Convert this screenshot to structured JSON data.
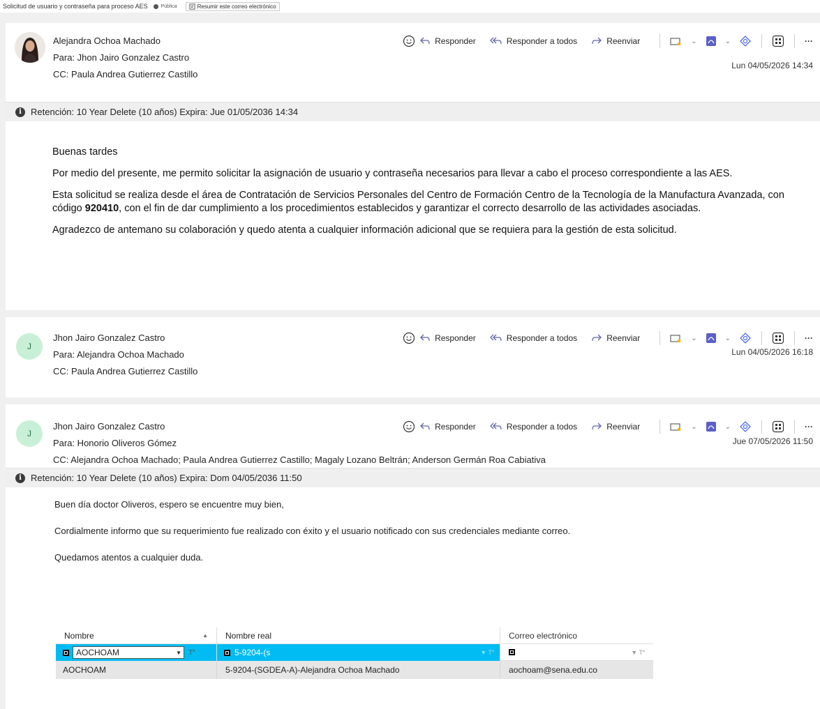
{
  "subject_bar": {
    "title": "Solicitud de usuario y contraseña para proceso AES",
    "sensitivity": "Pública",
    "summarize_label": "Resumir este correo electrónico"
  },
  "actions": {
    "reply": "Responder",
    "reply_all": "Responder a todos",
    "forward": "Reenviar",
    "more": "···"
  },
  "messages": [
    {
      "sender": "Alejandra Ochoa Machado",
      "to": "Para:  Jhon Jairo Gonzalez Castro",
      "cc": "CC:  Paula Andrea Gutierrez Castillo",
      "date": "Lun 04/05/2026 14:34",
      "retention": "Retención: 10 Year Delete (10 años) Expira: Jue 01/05/2036 14:34",
      "body": [
        "Buenas tardes",
        "Por medio del presente, me permito solicitar la asignación de usuario y contraseña necesarios para llevar a cabo el proceso correspondiente a las AES.",
        "Esta solicitud se realiza desde el área de Contratación de Servicios Personales del Centro de Formación Centro de la Tecnología de la Manufactura Avanzada, con código",
        "920410",
        ", con el fin de dar cumplimiento a los procedimientos establecidos y garantizar el correcto desarrollo de las actividades asociadas.",
        "Agradezco de antemano su colaboración y quedo atenta a cualquier información adicional que se requiera para la gestión de esta solicitud."
      ]
    },
    {
      "avatar_initial": "J",
      "sender": "Jhon Jairo Gonzalez Castro",
      "to": "Para:  Alejandra Ochoa Machado",
      "cc": "CC:  Paula Andrea Gutierrez Castillo",
      "date": "Lun 04/05/2026 16:18"
    },
    {
      "avatar_initial": "J",
      "sender": "Jhon Jairo Gonzalez Castro",
      "to": "Para:  Honorio Oliveros Gómez",
      "cc": "CC:  Alejandra Ochoa Machado;   Paula Andrea Gutierrez Castillo;   Magaly Lozano Beltrán;   Anderson Germán Roa Cabiativa",
      "date": "Jue 07/05/2026 11:50",
      "retention": "Retención: 10 Year Delete (10 años) Expira: Dom 04/05/2036 11:50",
      "body": [
        "Buen día doctor Oliveros, espero se encuentre muy bien,",
        "Cordialmente informo que su requerimiento fue realizado con éxito y el usuario notificado con sus credenciales mediante correo.",
        "Quedamos atentos a cualquier duda."
      ]
    }
  ],
  "grid": {
    "headers": [
      "Nombre",
      "Nombre real",
      "Correo electrónico"
    ],
    "filters": [
      "AOCHOAM",
      "5-9204-(s",
      ""
    ],
    "row": [
      "AOCHOAM",
      "5-9204-(SGDEA-A)-Alejandra Ochoa Machado",
      "aochoam@sena.edu.co"
    ]
  }
}
